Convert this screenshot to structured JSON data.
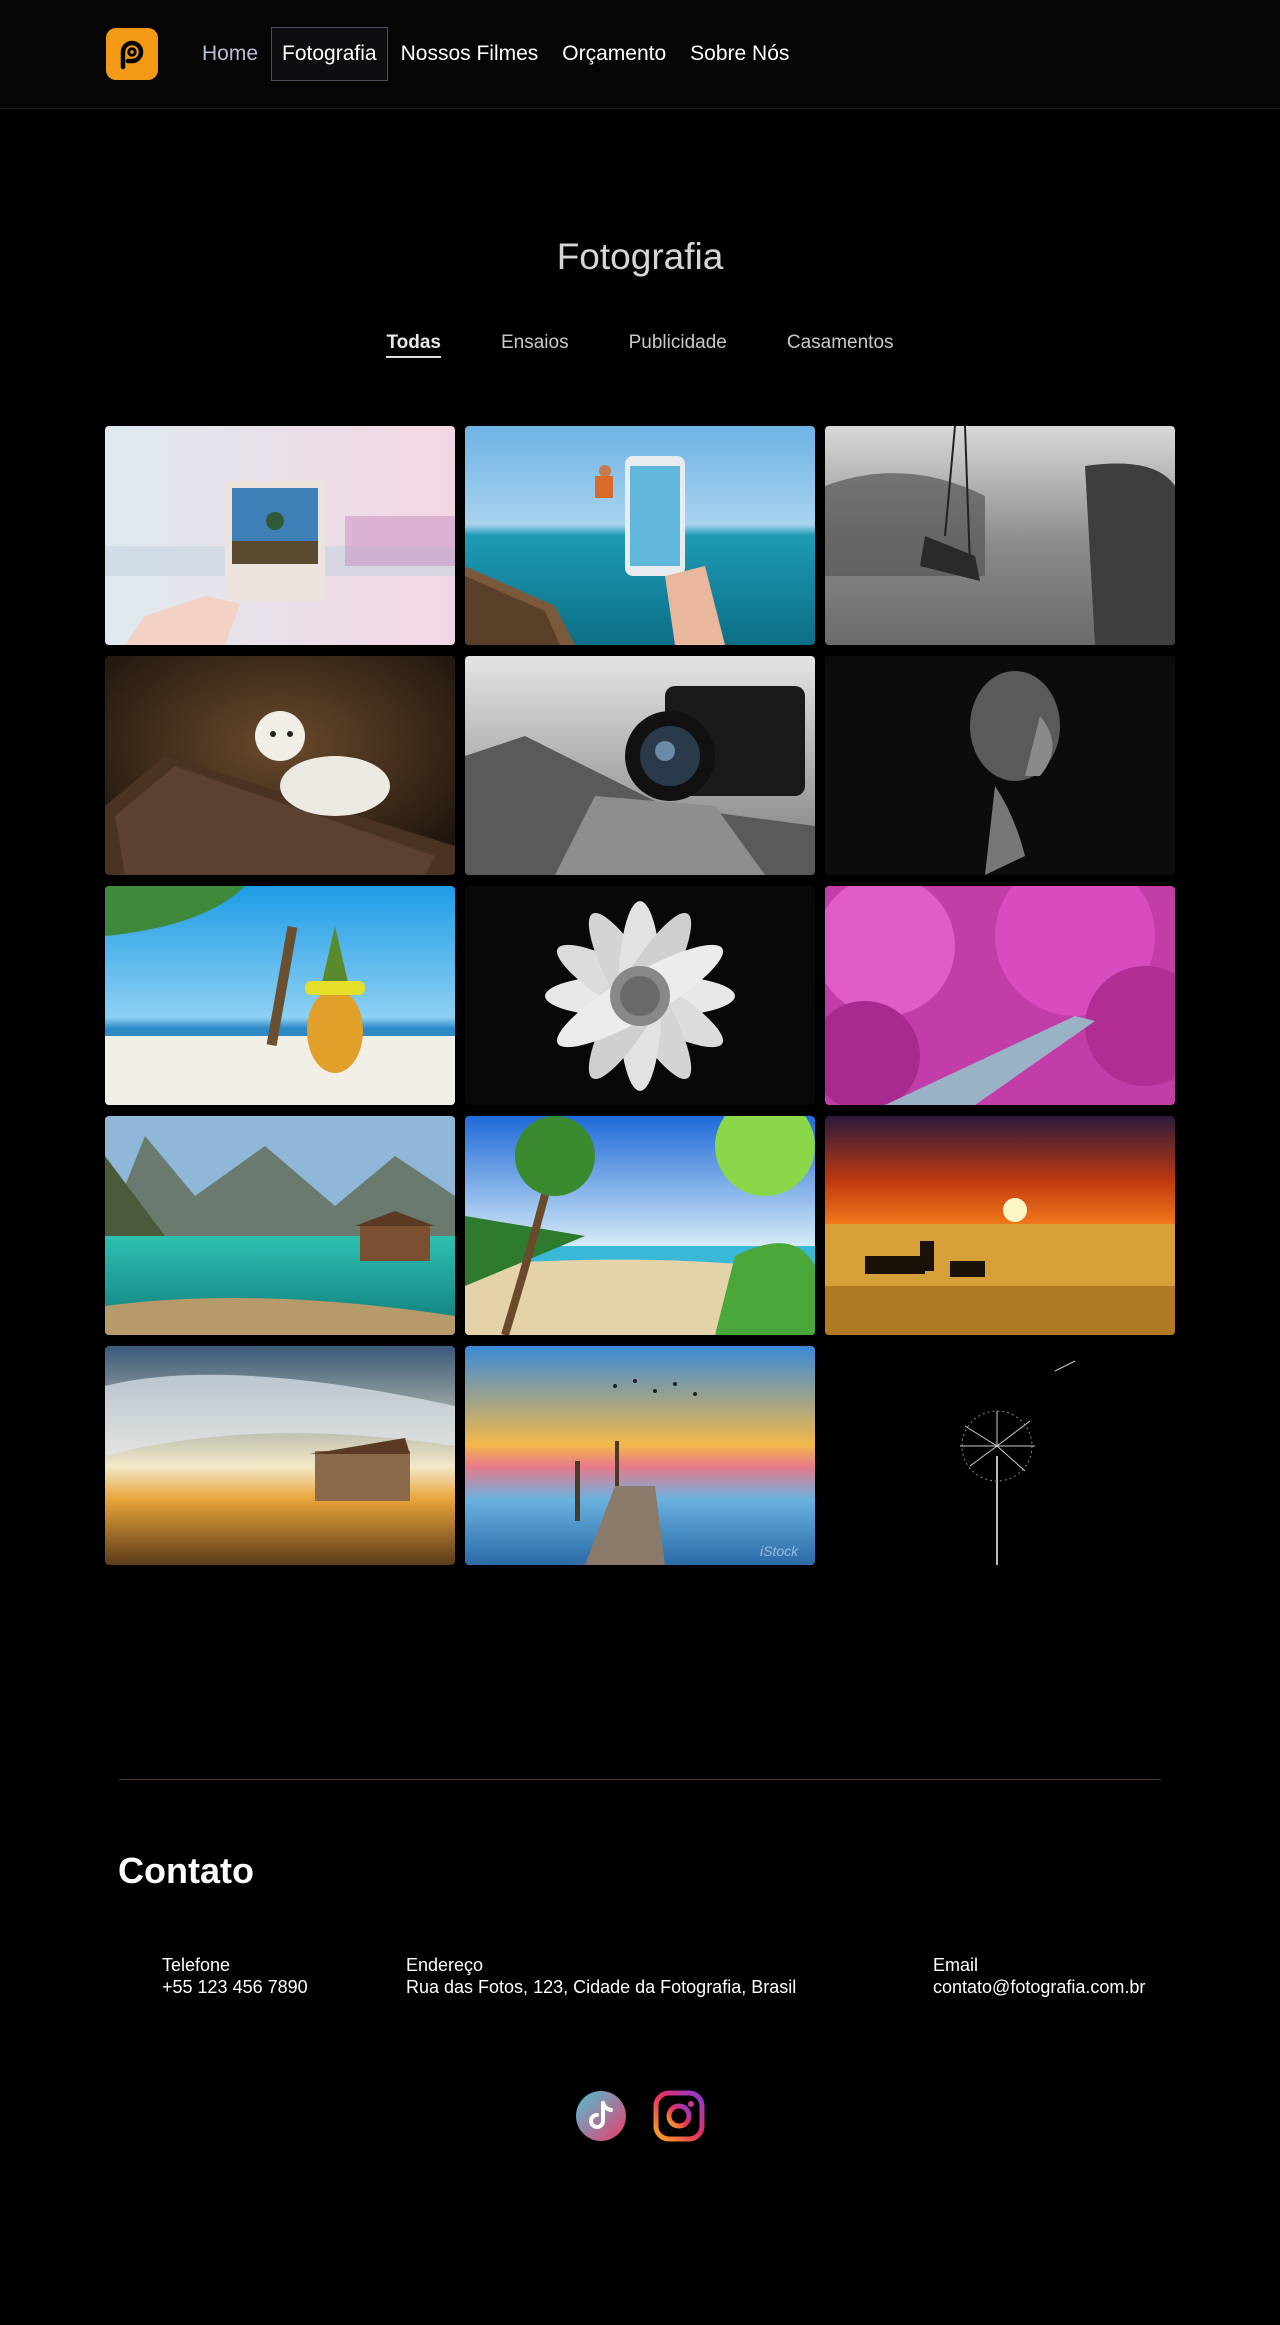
{
  "header": {
    "logo_icon": "camera-swirl-logo",
    "accent": "#f29a16",
    "nav": [
      {
        "label": "Home"
      },
      {
        "label": "Fotografia"
      },
      {
        "label": "Nossos Filmes"
      },
      {
        "label": "Orçamento"
      },
      {
        "label": "Sobre Nós"
      }
    ]
  },
  "page": {
    "title": "Fotografia",
    "filters": [
      {
        "label": "Todas"
      },
      {
        "label": "Ensaios"
      },
      {
        "label": "Publicidade"
      },
      {
        "label": "Casamentos"
      }
    ]
  },
  "gallery": {
    "images": [
      {
        "name": "polaroid-photo"
      },
      {
        "name": "phone-jumping-boat"
      },
      {
        "name": "swing-bw"
      },
      {
        "name": "white-lion-cub"
      },
      {
        "name": "camera-on-rocks"
      },
      {
        "name": "woman-portrait-bw"
      },
      {
        "name": "pineapple-beach"
      },
      {
        "name": "daisy-bw"
      },
      {
        "name": "pink-forest-road"
      },
      {
        "name": "mountain-lake"
      },
      {
        "name": "tropical-beach-palms"
      },
      {
        "name": "savanna-sunset-zebras"
      },
      {
        "name": "sunset-cabin"
      },
      {
        "name": "pier-sunset-birds"
      },
      {
        "name": "dandelion"
      }
    ],
    "watermark": "iStock"
  },
  "contact": {
    "title": "Contato",
    "phone_label": "Telefone",
    "phone": "+55 123 456 7890",
    "address_label": "Endereço",
    "address": "Rua das Fotos, 123, Cidade da Fotografia, Brasil",
    "email_label": "Email",
    "email": "contato@fotografia.com.br"
  },
  "social": {
    "tiktok_icon": "tiktok-icon",
    "instagram_icon": "instagram-icon"
  }
}
